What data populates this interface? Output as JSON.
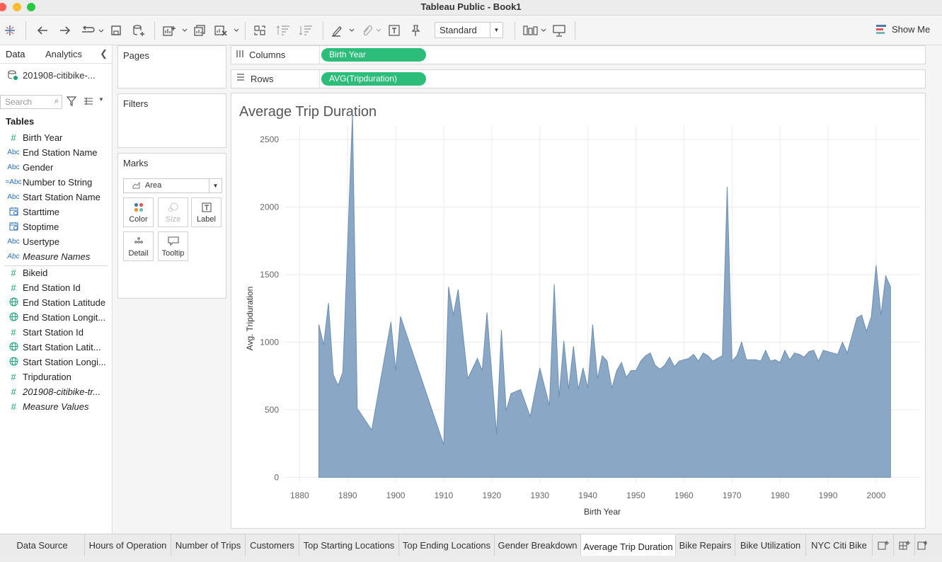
{
  "window": {
    "title": "Tableau Public - Book1"
  },
  "toolbar": {
    "fit_value": "Standard",
    "show_me_label": "Show Me"
  },
  "data_pane": {
    "tabs": [
      "Data",
      "Analytics"
    ],
    "datasource": "201908-citibike-...",
    "search_placeholder": "Search",
    "tables_header": "Tables",
    "dimensions": [
      {
        "name": "Birth Year",
        "type": "#"
      },
      {
        "name": "End Station Name",
        "type": "Abc"
      },
      {
        "name": "Gender",
        "type": "Abc"
      },
      {
        "name": "Number to String",
        "type": "=Abc"
      },
      {
        "name": "Start Station Name",
        "type": "Abc"
      },
      {
        "name": "Starttime",
        "type": "date"
      },
      {
        "name": "Stoptime",
        "type": "date"
      },
      {
        "name": "Usertype",
        "type": "Abc"
      },
      {
        "name": "Measure Names",
        "type": "Abc"
      }
    ],
    "measures": [
      {
        "name": "Bikeid",
        "type": "#"
      },
      {
        "name": "End Station Id",
        "type": "#"
      },
      {
        "name": "End Station Latitude",
        "type": "geo"
      },
      {
        "name": "End Station Longit...",
        "type": "geo"
      },
      {
        "name": "Start Station Id",
        "type": "#"
      },
      {
        "name": "Start Station Latit...",
        "type": "geo"
      },
      {
        "name": "Start Station Longi...",
        "type": "geo"
      },
      {
        "name": "Tripduration",
        "type": "#"
      },
      {
        "name": "201908-citibike-tr...",
        "type": "#"
      },
      {
        "name": "Measure Values",
        "type": "#"
      }
    ]
  },
  "cards": {
    "pages": "Pages",
    "filters": "Filters",
    "marks": "Marks",
    "mark_type": "Area",
    "mark_buttons": [
      "Color",
      "Size",
      "Label",
      "Detail",
      "Tooltip"
    ]
  },
  "shelves": {
    "columns_label": "Columns",
    "columns_pill": "Birth Year",
    "rows_label": "Rows",
    "rows_pill": "AVG(Tripduration)"
  },
  "sheet": {
    "title": "Average Trip Duration"
  },
  "chart_data": {
    "type": "area",
    "title": "Average Trip Duration",
    "xlabel": "Birth Year",
    "ylabel": "Avg. Tripduration",
    "xlim": [
      1877,
      2009
    ],
    "ylim": [
      -40,
      2600
    ],
    "x_ticks": [
      1880,
      1890,
      1900,
      1910,
      1920,
      1930,
      1940,
      1950,
      1960,
      1970,
      1980,
      1990,
      2000
    ],
    "y_ticks": [
      0,
      500,
      1000,
      1500,
      2000,
      2500
    ],
    "grid": true,
    "color": "#8aa8c6",
    "line_color": "#6e8fb1",
    "x": [
      1884,
      1885,
      1886,
      1887,
      1888,
      1889,
      1891,
      1892,
      1895,
      1899,
      1900,
      1901,
      1910,
      1911,
      1912,
      1913,
      1915,
      1917,
      1918,
      1919,
      1920,
      1921,
      1922,
      1923,
      1924,
      1926,
      1928,
      1930,
      1932,
      1933,
      1934,
      1935,
      1936,
      1937,
      1938,
      1939,
      1940,
      1941,
      1942,
      1943,
      1944,
      1945,
      1946,
      1947,
      1948,
      1949,
      1950,
      1951,
      1952,
      1953,
      1954,
      1955,
      1956,
      1957,
      1958,
      1959,
      1960,
      1961,
      1962,
      1963,
      1964,
      1965,
      1966,
      1967,
      1968,
      1969,
      1970,
      1971,
      1972,
      1973,
      1974,
      1975,
      1976,
      1977,
      1978,
      1979,
      1980,
      1981,
      1982,
      1983,
      1984,
      1985,
      1986,
      1987,
      1988,
      1989,
      1990,
      1991,
      1992,
      1993,
      1994,
      1995,
      1996,
      1997,
      1998,
      1999,
      2000,
      2001,
      2002,
      2003
    ],
    "y": [
      1130,
      980,
      1290,
      760,
      680,
      780,
      2690,
      510,
      350,
      1150,
      790,
      1190,
      240,
      1410,
      1200,
      1390,
      730,
      880,
      790,
      1220,
      760,
      320,
      1090,
      490,
      620,
      650,
      450,
      810,
      530,
      1430,
      590,
      1010,
      650,
      970,
      650,
      810,
      660,
      1130,
      730,
      900,
      860,
      660,
      790,
      850,
      740,
      790,
      790,
      860,
      900,
      920,
      830,
      800,
      830,
      890,
      820,
      860,
      870,
      880,
      910,
      860,
      920,
      900,
      860,
      880,
      900,
      2150,
      860,
      900,
      1000,
      870,
      870,
      870,
      860,
      940,
      860,
      870,
      850,
      940,
      870,
      920,
      910,
      890,
      930,
      940,
      860,
      940,
      930,
      920,
      910,
      1000,
      920,
      1050,
      1180,
      1200,
      1080,
      1190,
      1570,
      1200,
      1490,
      1410
    ]
  },
  "bottom_tabs": [
    "Data Source",
    "Hours of Operation",
    "Number of Trips",
    "Customers",
    "Top Starting Locations",
    "Top Ending Locations",
    "Gender Breakdown",
    "Average Trip Duration",
    "Bike Repairs",
    "Bike Utilization",
    "NYC Citi Bike"
  ],
  "active_tab": "Average Trip Duration"
}
